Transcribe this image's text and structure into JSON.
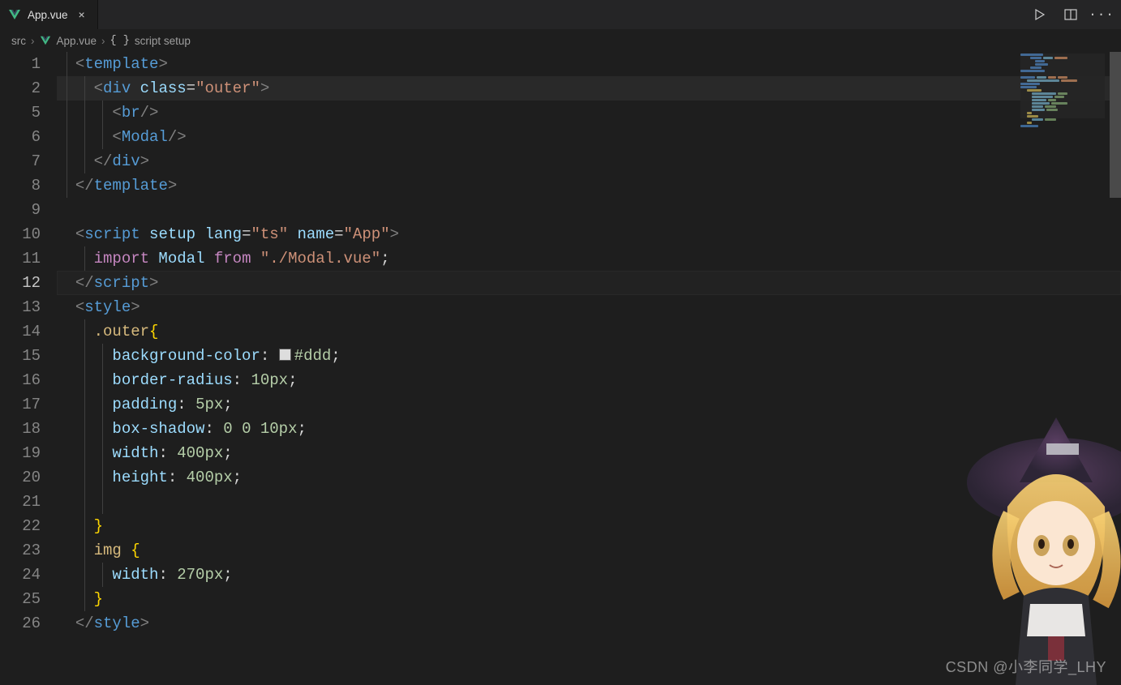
{
  "tab": {
    "icon": "vue-icon",
    "title": "App.vue",
    "close": "×"
  },
  "toolbar": {
    "run": "▷",
    "split": "split-editor-icon",
    "more": "···"
  },
  "breadcrumbs": {
    "p0": "src",
    "p1_icon": "vue-icon",
    "p1": "App.vue",
    "p2_icon": "brace-icon",
    "p2": "script setup"
  },
  "gutter": [
    "1",
    "2",
    "5",
    "6",
    "7",
    "8",
    "9",
    "10",
    "11",
    "12",
    "13",
    "14",
    "15",
    "16",
    "17",
    "18",
    "19",
    "20",
    "21",
    "22",
    "23",
    "24",
    "25",
    "26"
  ],
  "active_line_index": 9,
  "highlight_line_index": 1,
  "css_swatch": "#ddd",
  "code": {
    "l1": {
      "a": "<",
      "b": "template",
      "c": ">"
    },
    "l2": {
      "a": "<",
      "b": "div",
      "sp": " ",
      "attr": "class",
      "eq": "=",
      "str": "\"outer\"",
      "c": ">"
    },
    "l5": {
      "a": "<",
      "b": "br",
      "c": "/>"
    },
    "l6": {
      "a": "<",
      "b": "Modal",
      "c": "/>"
    },
    "l7": {
      "a": "</",
      "b": "div",
      "c": ">"
    },
    "l8": {
      "a": "</",
      "b": "template",
      "c": ">"
    },
    "l10": {
      "a": "<",
      "b": "script",
      "attrs": [
        [
          "setup",
          ""
        ],
        [
          "lang",
          "\"ts\""
        ],
        [
          "name",
          "\"App\""
        ]
      ],
      "c": ">"
    },
    "l11": {
      "kw1": "import",
      "mod": " Modal ",
      "kw2": "from",
      "str": " \"./Modal.vue\"",
      "semi": ";"
    },
    "l12": {
      "a": "</",
      "b": "script",
      "c": ">"
    },
    "l13": {
      "a": "<",
      "b": "style",
      "c": ">"
    },
    "l14": {
      "sel": ".outer",
      "brace": "{"
    },
    "l15": {
      "prop": "background-color",
      "colon": ": ",
      "swatch": "#ddd",
      "val": "#ddd",
      "semi": ";"
    },
    "l16": {
      "prop": "border-radius",
      "colon": ": ",
      "val": "10px",
      "semi": ";"
    },
    "l17": {
      "prop": "padding",
      "colon": ": ",
      "val": "5px",
      "semi": ";"
    },
    "l18": {
      "prop": "box-shadow",
      "colon": ": ",
      "val": "0 0 10px",
      "semi": ";"
    },
    "l19": {
      "prop": "width",
      "colon": ": ",
      "val": "400px",
      "semi": ";"
    },
    "l20": {
      "prop": "height",
      "colon": ": ",
      "val": "400px",
      "semi": ";"
    },
    "l22": {
      "brace": "}"
    },
    "l23": {
      "sel": "img ",
      "brace": "{"
    },
    "l24": {
      "prop": "width",
      "colon": ": ",
      "val": "270px",
      "semi": ";"
    },
    "l25": {
      "brace": "}"
    },
    "l26": {
      "a": "</",
      "b": "style",
      "c": ">"
    }
  },
  "scroll": {
    "thumb_top": 0,
    "thumb_height": 180
  },
  "watermark": "CSDN @小李同学_LHY"
}
